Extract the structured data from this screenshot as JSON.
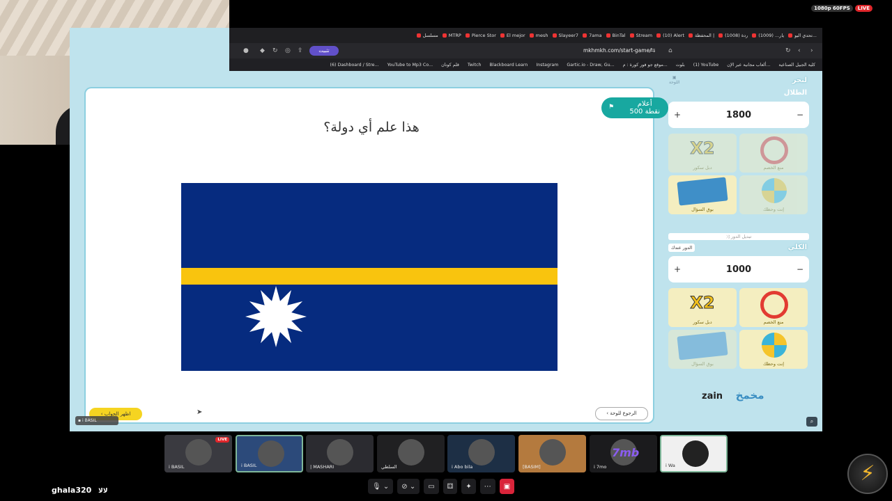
{
  "stream": {
    "quality": "1080p 60FPS",
    "live": "LIVE"
  },
  "browser": {
    "tabs": [
      "تحدي اليو...",
      "يار... (1009)",
      "(1008) ردة",
      "المحفظة |",
      "(10) Alert",
      "Stream",
      "BinTal",
      "7ama",
      "Slayeer7",
      "mesh",
      "El mejor",
      "Pierce Stor",
      "MTRP",
      "مسلسل"
    ],
    "url": "mkhmkh.com/start-game/",
    "install_label": "تثبيت",
    "bookmarks": [
      "كلية الجبيل الصناعية",
      "ألعاب مجانية عبر الإن...",
      "(1) YouTube",
      "بلوت",
      "موقع جو فور كورة : م...",
      "Gartic.io - Draw, Gu...",
      "Instagram",
      "Blackboard Learn",
      "Twitch",
      "قلم كونان",
      "YouTube to Mp3 Co...",
      "(6) Dashboard / Stre..."
    ]
  },
  "game": {
    "category": "أعلام",
    "points": "500 نقطة",
    "question": "هذا علم أي دولة؟",
    "show_answer": "اظهر الجواب",
    "back_to_board": "الرجوع للوحة",
    "controller_badge": "i BASIL",
    "board_link": "اللوحة"
  },
  "team1": {
    "name": "لنحر",
    "sub": "الطلال",
    "score": "1800",
    "aids": [
      {
        "label": "دبل سكور",
        "icon": "x2-icon",
        "big": "X2",
        "dim": true
      },
      {
        "label": "منع الخصم",
        "icon": "block-icon",
        "dim": true
      },
      {
        "label": "بوق السؤال",
        "icon": "cards-icon",
        "dim": false
      },
      {
        "label": "إنت وحظك",
        "icon": "wheel-icon",
        "dim": true
      }
    ]
  },
  "switch_turn": "تبديل الدور",
  "team2": {
    "name": "الكلي",
    "turn": "الدور عندك",
    "score": "1000",
    "aids": [
      {
        "label": "دبل سكور",
        "icon": "x2-icon",
        "big": "X2",
        "dim": false
      },
      {
        "label": "منع الخصم",
        "icon": "block-icon",
        "dim": false
      },
      {
        "label": "بوق السؤال",
        "icon": "cards-icon",
        "dim": true
      },
      {
        "label": "إنت وحظك",
        "icon": "wheel-icon",
        "dim": false
      }
    ]
  },
  "sponsor": {
    "zain": "zain",
    "ar": "مخمخ"
  },
  "participants": [
    {
      "name": "i BASIL",
      "live": "LIVE",
      "color": "#3a3a40"
    },
    {
      "name": "i BASIL",
      "color": "#2c4a7a"
    },
    {
      "name": "| MASHARI",
      "color": "#2b2b30"
    },
    {
      "name": "السلطي",
      "color": "#202022"
    },
    {
      "name": "i Abo bila",
      "color": "#1d2f45"
    },
    {
      "name": "[BASIM]",
      "color": "#b47a3e"
    },
    {
      "name": "i 7mo",
      "big": "7mb",
      "color": "#1b1b1d"
    },
    {
      "name": "i Wa",
      "color": "#f0f0f0"
    }
  ],
  "user": {
    "name": "ghala320",
    "tag": "ﻻﻻ"
  },
  "colors": {
    "accent": "#18a8a0",
    "flag_blue": "#062b7f",
    "flag_yellow": "#f9c40e",
    "answer_btn": "#f5d421",
    "panel_bg": "#bfe3ed"
  }
}
